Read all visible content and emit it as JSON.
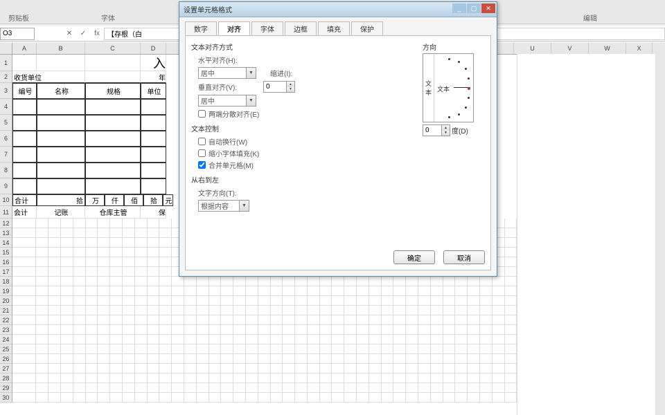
{
  "ribbon": {
    "group_clipboard": "剪贴板",
    "group_font": "字体",
    "group_edit": "编辑"
  },
  "formula_bar": {
    "name_box": "O3",
    "value": "【存根（白",
    "fx": "fx"
  },
  "columns": [
    "A",
    "B",
    "C",
    "D",
    "U",
    "V",
    "W",
    "X"
  ],
  "col_widths": {
    "A": 35,
    "B": 70,
    "C": 80,
    "D": 37
  },
  "sheet": {
    "r2_A": "收货单位",
    "r2_D": "年",
    "r2_C_char": "入",
    "r3_A": "编号",
    "r3_B": "名称",
    "r3_C": "规格",
    "r3_D": "单位",
    "r10_A": "合计",
    "r10_bai": "拾",
    "r10_wan": "万",
    "r10_qian": "仟",
    "r10_bai2": "佰",
    "r10_shi": "拾",
    "r10_yuan": "元",
    "r11_A": "会计",
    "r11_B": "记账",
    "r11_C": "仓库主管",
    "r11_D": "保"
  },
  "dialog": {
    "title": "设置单元格格式",
    "tabs": [
      "数字",
      "对齐",
      "字体",
      "边框",
      "填充",
      "保护"
    ],
    "active_tab": 1,
    "sections": {
      "text_align": "文本对齐方式",
      "h_align": "水平对齐(H):",
      "v_align": "垂直对齐(V):",
      "indent": "缩进(I):",
      "distributed": "两端分散对齐(E)",
      "text_ctrl": "文本控制",
      "wrap": "自动换行(W)",
      "shrink": "缩小字体填充(K)",
      "merge": "合并单元格(M)",
      "rtl": "从右到左",
      "text_dir": "文字方向(T):"
    },
    "values": {
      "h_align_val": "居中",
      "v_align_val": "居中",
      "indent_val": "0",
      "text_dir_val": "根据内容",
      "orient_val": "0",
      "orient_unit": "度(D)"
    },
    "checks": {
      "distributed": false,
      "wrap": false,
      "shrink": false,
      "merge": true
    },
    "orient": {
      "label": "方向",
      "vchar1": "文",
      "vchar2": "本",
      "dial_text": "文本"
    },
    "buttons": {
      "ok": "确定",
      "cancel": "取消"
    }
  }
}
